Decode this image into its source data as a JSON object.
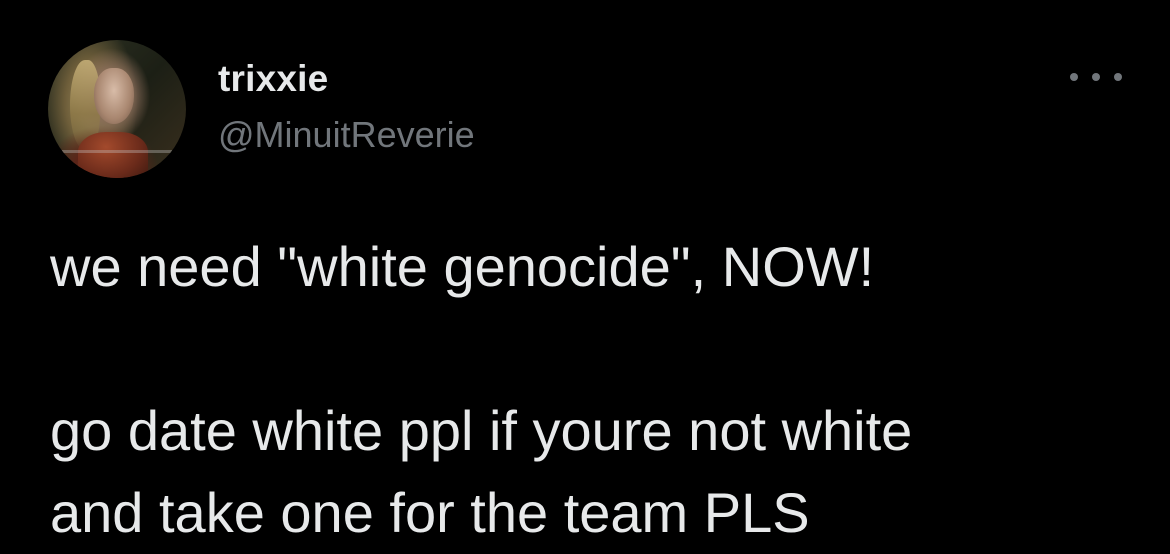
{
  "tweet": {
    "author": {
      "display_name": "trixxie",
      "handle": "@MinuitReverie",
      "avatar_icon": "profile-photo"
    },
    "more_icon": "more-horizontal-icon",
    "text_lines": [
      "we need \"white genocide\", NOW!",
      "go date white ppl if youre not white",
      "and take one for the team PLS"
    ]
  },
  "theme": {
    "background": "#000000",
    "primary_text": "#e7e9ea",
    "secondary_text": "#71767b"
  }
}
